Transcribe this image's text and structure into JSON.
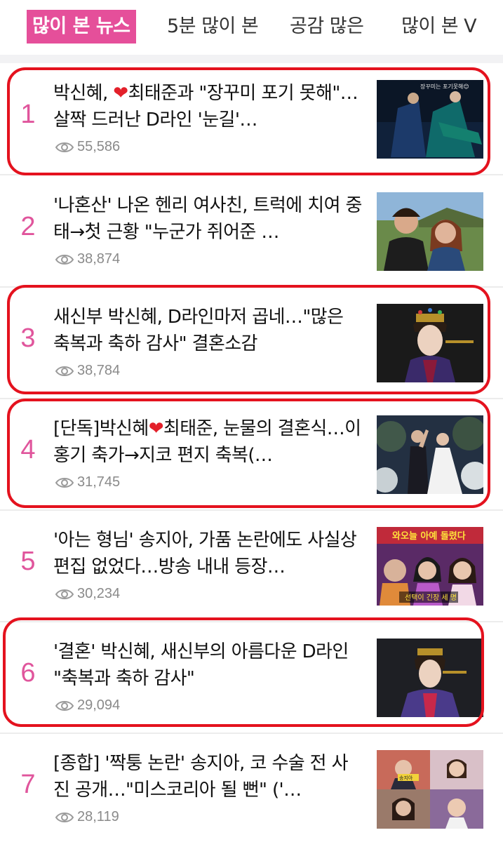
{
  "tabs": [
    {
      "label": "많이 본 뉴스",
      "active": true
    },
    {
      "label": "5분 많이 본",
      "active": false
    },
    {
      "label": "공감 많은",
      "active": false
    },
    {
      "label": "많이 본 V",
      "active": false
    }
  ],
  "colors": {
    "accent": "#e54f9a",
    "highlight": "#e4121e",
    "heart": "#e3202a"
  },
  "news": [
    {
      "rank": "1",
      "headline": [
        "박신혜, ",
        "최태준과 \"장꾸미 포기 못해\"…살짝 드러난 D라인 '눈길'…"
      ],
      "views": "55,586",
      "highlighted": true,
      "thumb_caption": "장꾸미는 포기못해😊"
    },
    {
      "rank": "2",
      "headline": [
        "'나혼산' 나온 헨리 여사친, 트럭에 치여 중태→첫 근황 \"누군가 쥐어준 …"
      ],
      "views": "38,874",
      "highlighted": false
    },
    {
      "rank": "3",
      "headline": [
        "새신부 박신혜, D라인마저 곱네…\"많은 축복과 축하 감사\" 결혼소감"
      ],
      "views": "38,784",
      "highlighted": true
    },
    {
      "rank": "4",
      "headline": [
        "[단독]박신혜",
        "최태준, 눈물의 결혼식…이홍기 축가→지코 편지 축복(…"
      ],
      "views": "31,745",
      "highlighted": true
    },
    {
      "rank": "5",
      "headline": [
        "'아는 형님' 송지아, 가품 논란에도 사실상 편집 없었다…방송 내내 등장…"
      ],
      "views": "30,234",
      "highlighted": false,
      "thumb_caption": "와오늘 아예 돌렸다",
      "thumb_sub": "선택이 긴장 세 명"
    },
    {
      "rank": "6",
      "headline": [
        "'결혼' 박신혜, 새신부의 아름다운 D라인 \"축복과 축하 감사\""
      ],
      "views": "29,094",
      "highlighted": true
    },
    {
      "rank": "7",
      "headline": [
        "[종합] '짝퉁 논란' 송지아, 코 수술 전 사진 공개…\"미스코리아 될 뻔\" ('…"
      ],
      "views": "28,119",
      "highlighted": false,
      "thumb_caption": "송지아"
    }
  ],
  "icons": {
    "views": "eye-icon",
    "heart": "heart-icon"
  }
}
